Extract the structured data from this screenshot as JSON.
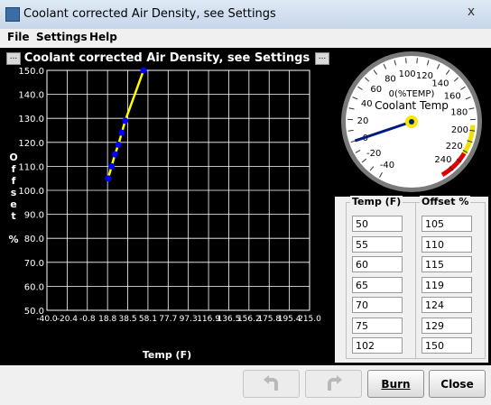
{
  "window": {
    "title": "Coolant corrected Air Density, see Settings",
    "close_glyph": "x"
  },
  "menu": {
    "file": "File",
    "settings": "Settings",
    "help": "Help"
  },
  "panel": {
    "corner_button_glyph": "..."
  },
  "chart_data": {
    "type": "line",
    "title": "Coolant corrected Air Density, see Settings",
    "xlabel": "Temp (F)",
    "ylabel": "Offset %",
    "x": [
      50,
      55,
      60,
      65,
      70,
      75,
      102
    ],
    "y": [
      105,
      110,
      115,
      119,
      124,
      129,
      150
    ],
    "xlim": [
      -40.0,
      346.0
    ],
    "ylim": [
      50.0,
      150.0
    ],
    "xticks": [
      "-40.0",
      "-20.4",
      "-0.8",
      "18.8",
      "38.5",
      "58.1",
      "77.7",
      "97.3",
      "116.9",
      "136.5",
      "156.2",
      "175.8",
      "195.4",
      "215.0"
    ],
    "yticks": [
      "50.0",
      "60.0",
      "70.0",
      "80.0",
      "90.0",
      "100.0",
      "110.0",
      "120.0",
      "130.0",
      "140.0",
      "150.0"
    ],
    "grid": true,
    "line_color": "#ffff00",
    "point_color": "#0000ff"
  },
  "gauge": {
    "title": "Coolant Temp",
    "value_text": "0(%TEMP)",
    "min": -40,
    "max": 250,
    "value": 0,
    "labels": [
      "-40",
      "-20",
      "0",
      "20",
      "40",
      "60",
      "80",
      "100",
      "120",
      "140",
      "160",
      "180",
      "200",
      "220",
      "240"
    ],
    "warn_color": "#f0e000",
    "danger_color": "#e00000",
    "needle_color": "#001a80"
  },
  "table": {
    "temp_header": "Temp (F)",
    "offset_header": "Offset %",
    "temps": [
      "50",
      "55",
      "60",
      "65",
      "70",
      "75",
      "102"
    ],
    "offsets": [
      "105",
      "110",
      "115",
      "119",
      "124",
      "129",
      "150"
    ]
  },
  "buttons": {
    "burn": "Burn",
    "close": "Close",
    "undo_icon": "undo-icon",
    "redo_icon": "redo-icon"
  }
}
